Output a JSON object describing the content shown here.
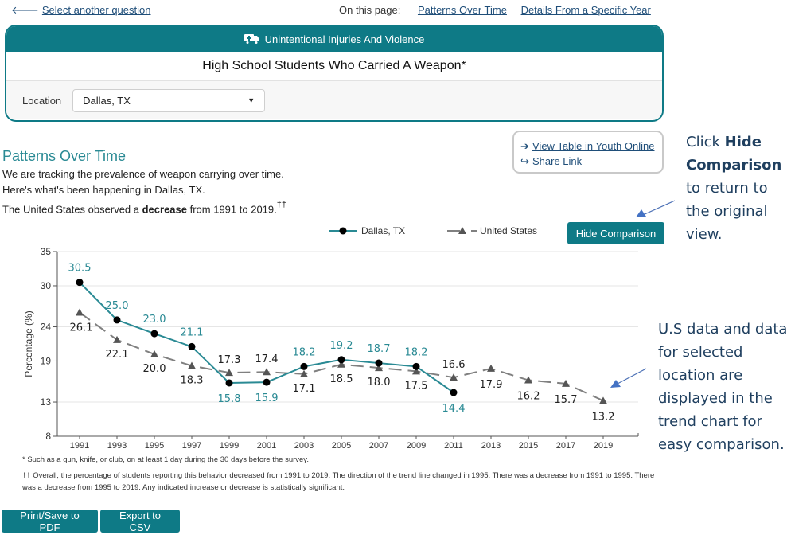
{
  "nav": {
    "back_link": "Select another question",
    "on_this_page_label": "On this page:",
    "links": [
      "Patterns Over Time",
      "Details From a Specific Year"
    ]
  },
  "header": {
    "category": "Unintentional Injuries And Violence",
    "category_icon": "ambulance-icon",
    "question_title": "High School Students Who Carried A Weapon*",
    "location_label": "Location",
    "location_value": "Dallas, TX"
  },
  "section": {
    "title": "Patterns Over Time",
    "line1": "We are tracking the prevalence of weapon carrying over time.",
    "line2": "Here's what's been happening in Dallas, TX.",
    "line3_pre": "The United States observed a ",
    "line3_bold": "decrease",
    "line3_post": " from 1991 to 2019.",
    "line3_marker": "††"
  },
  "links_box": {
    "view_table": "View Table in Youth Online",
    "share_link": "Share Link"
  },
  "hide_comparison_button": "Hide Comparison",
  "annotations": {
    "top_pre": "Click ",
    "top_bold": "Hide Comparison",
    "top_post": " to return to the original view.",
    "bottom": "U.S data and data for selected location are displayed in the trend chart for easy comparison."
  },
  "footnotes": {
    "asterisk": "* Such as a gun, knife, or club, on at least 1 day during the 30 days before the survey.",
    "dagger": "†† Overall, the percentage of students reporting this behavior decreased from 1991 to 2019. The direction of the trend line changed in 1995. There was a decrease from 1991 to 1995. There was a decrease from 1995 to 2019. Any indicated increase or decrease is statistically significant."
  },
  "buttons": {
    "print": "Print/Save to PDF",
    "export": "Export to CSV"
  },
  "chart_data": {
    "type": "line",
    "title": "",
    "xlabel": "",
    "ylabel": "Percentage (%)",
    "ylim": [
      8,
      35
    ],
    "yticks": [
      8,
      13,
      19,
      24,
      30,
      35
    ],
    "grid": true,
    "legend_position": "top-right",
    "x": [
      "1991",
      "1993",
      "1995",
      "1997",
      "1999",
      "2001",
      "2003",
      "2005",
      "2007",
      "2009",
      "2011",
      "2013",
      "2015",
      "2017",
      "2019"
    ],
    "series": [
      {
        "name": "Dallas, TX",
        "color": "#2a8a94",
        "marker": "circle",
        "dash": false,
        "values": [
          30.5,
          25.0,
          23.0,
          21.1,
          15.8,
          15.9,
          18.2,
          19.2,
          18.7,
          18.2,
          14.4,
          null,
          null,
          null,
          null
        ]
      },
      {
        "name": "United States",
        "color": "#808080",
        "marker": "triangle",
        "dash": true,
        "values": [
          26.1,
          22.1,
          20.0,
          18.3,
          17.3,
          17.4,
          17.1,
          18.5,
          18.0,
          17.5,
          16.6,
          17.9,
          16.2,
          15.7,
          13.2
        ]
      }
    ]
  }
}
